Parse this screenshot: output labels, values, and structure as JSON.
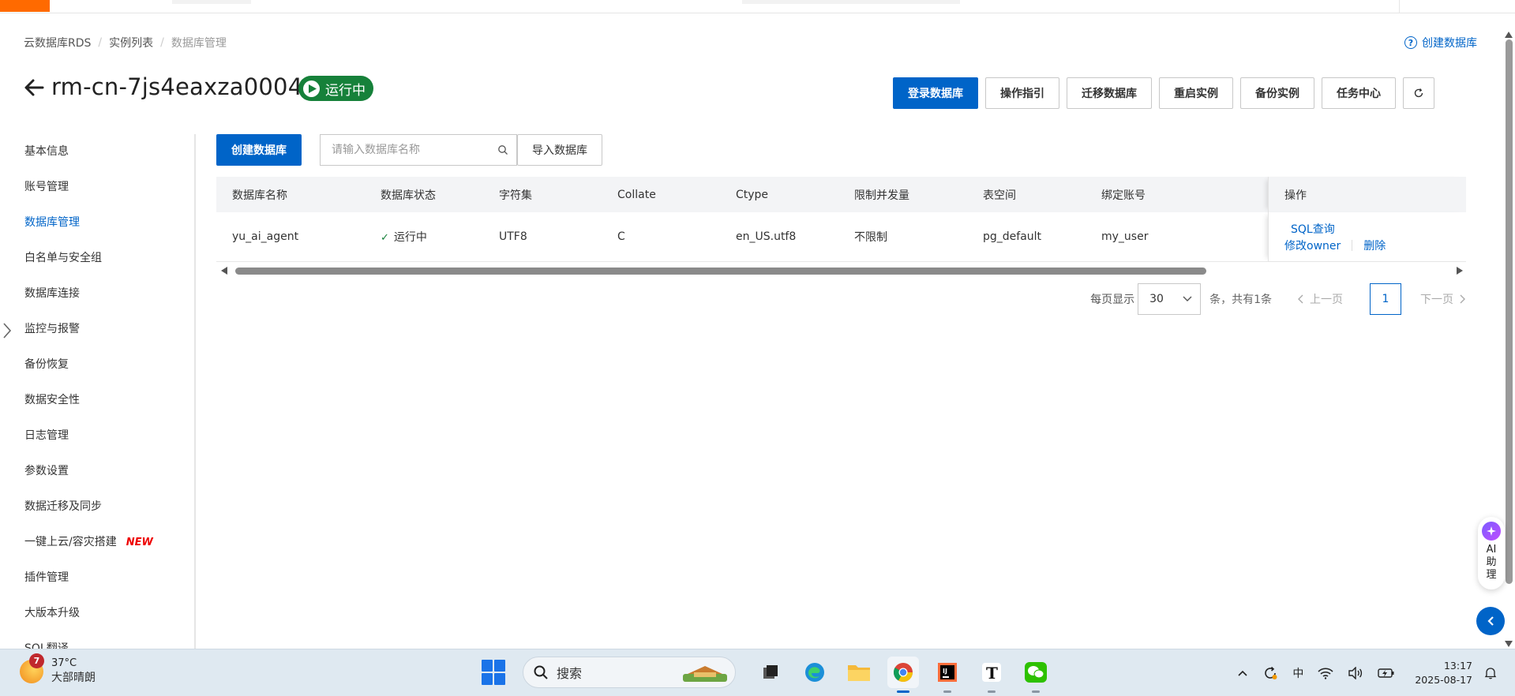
{
  "breadcrumb": [
    "云数据库RDS",
    "实例列表",
    "数据库管理"
  ],
  "header": {
    "help_link": "创建数据库",
    "instance_id": "rm-cn-7js4eaxza00043",
    "status": "运行中",
    "actions": [
      "登录数据库",
      "操作指引",
      "迁移数据库",
      "重启实例",
      "备份实例",
      "任务中心"
    ]
  },
  "sidebar": {
    "items": [
      {
        "label": "基本信息"
      },
      {
        "label": "账号管理"
      },
      {
        "label": "数据库管理"
      },
      {
        "label": "白名单与安全组"
      },
      {
        "label": "数据库连接"
      },
      {
        "label": "监控与报警"
      },
      {
        "label": "备份恢复"
      },
      {
        "label": "数据安全性"
      },
      {
        "label": "日志管理"
      },
      {
        "label": "参数设置"
      },
      {
        "label": "数据迁移及同步"
      },
      {
        "label": "一键上云/容灾搭建",
        "tag": "NEW"
      },
      {
        "label": "插件管理"
      },
      {
        "label": "大版本升级"
      },
      {
        "label": "SQL翻译"
      }
    ],
    "active_index": 2
  },
  "toolbar": {
    "create_button": "创建数据库",
    "search_placeholder": "请输入数据库名称",
    "import_button": "导入数据库"
  },
  "table": {
    "headers": [
      "数据库名称",
      "数据库状态",
      "字符集",
      "Collate",
      "Ctype",
      "限制并发量",
      "表空间",
      "绑定账号",
      "操作"
    ],
    "rows": [
      {
        "name": "yu_ai_agent",
        "status": "运行中",
        "charset": "UTF8",
        "collate": "C",
        "ctype": "en_US.utf8",
        "concurrency": "不限制",
        "tablespace": "pg_default",
        "account": "my_user",
        "ops": [
          "SQL查询",
          "修改owner",
          "删除"
        ]
      }
    ]
  },
  "pagination": {
    "per_page_label": "每页显示",
    "page_size": "30",
    "total_text": "条，共有1条",
    "prev": "上一页",
    "current_page": "1",
    "next": "下一页"
  },
  "ai_assistant": {
    "label": "AI助理"
  },
  "taskbar": {
    "weather_badge": "7",
    "temperature": "37°C",
    "weather_desc": "大部晴朗",
    "search_label": "搜索",
    "apps": [
      "file-explorer-dark",
      "edge",
      "folder",
      "chrome",
      "intellij",
      "typora",
      "wechat"
    ],
    "active_app": "chrome",
    "ime": "中",
    "time": "13:17",
    "date": "2025-08-17"
  },
  "colors": {
    "primary": "#0064c8",
    "success": "#16813a",
    "new_tag": "#e00000",
    "brand": "#ff6a00"
  }
}
